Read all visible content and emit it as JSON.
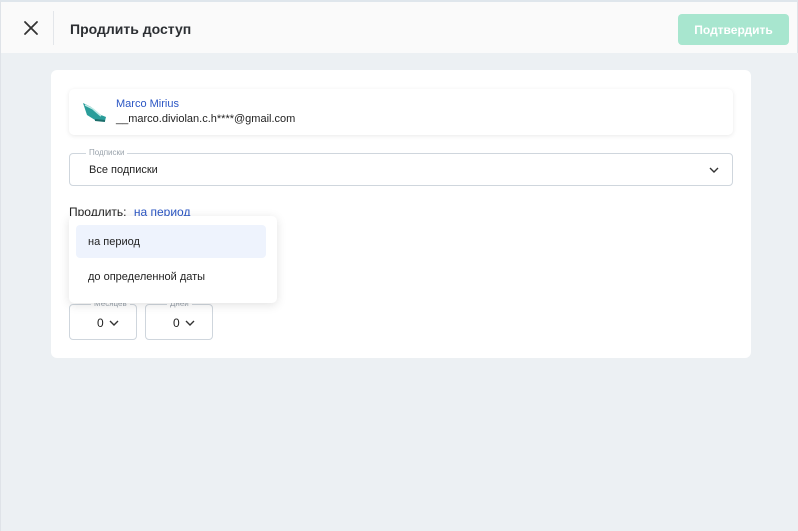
{
  "header": {
    "title": "Продлить доступ",
    "confirm_label": "Подтвердить",
    "close_icon": "close-icon"
  },
  "user": {
    "name": "Marco Mirius",
    "email": "__marco.diviolan.c.h****@gmail.com",
    "avatar_icon": "shoe-avatar-icon"
  },
  "subscriptions": {
    "label": "Подписки",
    "value": "Все подписки"
  },
  "extend": {
    "label": "Продлить:",
    "mode": "на период"
  },
  "dropdown": {
    "options": [
      "на период",
      "до определенной даты"
    ],
    "selected_index": 0
  },
  "period": {
    "months_label": "Месяцев",
    "months_value": "0",
    "days_label": "Дней",
    "days_value": "0"
  },
  "colors": {
    "accent_link": "#2b56c4",
    "confirm_disabled": "#a8e6cf",
    "option_highlight": "#eef3fd",
    "avatar_teal": "#2a9d9a"
  }
}
